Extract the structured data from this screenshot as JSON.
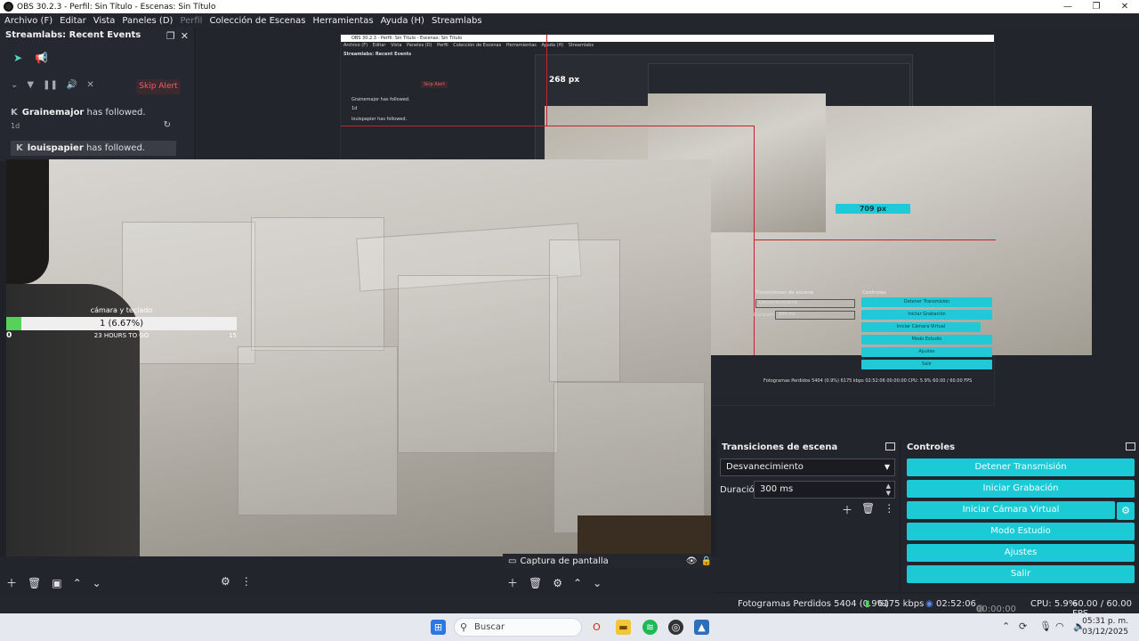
{
  "window": {
    "title": "OBS 30.2.3 - Perfil: Sin Título - Escenas: Sin Título",
    "controls": [
      "—",
      "❐",
      "✕"
    ]
  },
  "menu": {
    "items": [
      "Archivo (F)",
      "Editar",
      "Vista",
      "Paneles (D)",
      "Perfil",
      "Colección de Escenas",
      "Herramientas",
      "Ayuda (H)",
      "Streamlabs"
    ]
  },
  "streamlabs": {
    "title": "Streamlabs: Recent Events",
    "skip_alert": "Skip Alert",
    "events": [
      {
        "user": "Grainemajor",
        "action": " has followed.",
        "time": "1d"
      },
      {
        "user": "louispapier",
        "action": " has followed."
      }
    ]
  },
  "goal": {
    "title": "cámara y teclado",
    "value_text": "1 (6.67%)",
    "progress_fraction": 0.0667,
    "start": "0",
    "remaining": "23 HOURS TO GO",
    "end": "15"
  },
  "nested_preview": {
    "title": "OBS 30.2.3 - Perfil: Sin Título - Escenas: Sin Título",
    "menu": [
      "Archivo (F)",
      "Editar",
      "Vista",
      "Paneles (D)",
      "Perfil",
      "Colección de Escenas",
      "Herramientas",
      "Ayuda (H)",
      "Streamlabs"
    ],
    "dock_title": "Streamlabs: Recent Events",
    "skip_alert": "Skip Alert",
    "event1": "Grainemajor has followed.",
    "event1_time": "1d",
    "event2": "louispapier has followed.",
    "measure_top": "268 px",
    "measure_right": "709 px",
    "trans_title": "Transiciones de escena",
    "controls_title": "Controles",
    "select": "Desvanecimiento",
    "duration_label": "Duración",
    "duration": "300 ms",
    "buttons": [
      "Detener Transmisión",
      "Iniciar Grabación",
      "Iniciar Cámara Virtual",
      "Modo Estudio",
      "Ajustes",
      "Salir"
    ],
    "status": "Fotogramas Perdidos 5404 (0.9%)   6175 kbps   02:52:06   00:00:00   CPU: 5.9%   60.00 / 60.00 FPS"
  },
  "sources": {
    "item_label": "Captura de pantalla"
  },
  "transitions": {
    "title": "Transiciones de escena",
    "selected": "Desvanecimiento",
    "duration_label": "Duración",
    "duration_value": "300 ms"
  },
  "controls": {
    "title": "Controles",
    "stop_stream": "Detener Transmisión",
    "start_recording": "Iniciar Grabación",
    "start_virtual_cam": "Iniciar Cámara Virtual",
    "studio_mode": "Modo Estudio",
    "settings": "Ajustes",
    "exit": "Salir"
  },
  "status": {
    "dropped_frames": "Fotogramas Perdidos 5404 (0.9%)",
    "bitrate": "6175 kbps",
    "stream_time": "02:52:06",
    "record_time": "00:00:00",
    "cpu": "CPU: 5.9%",
    "fps": "60.00 / 60.00 FPS"
  },
  "taskbar": {
    "search_placeholder": "Buscar",
    "time": "05:31 p. m.",
    "date": "03/12/2025"
  },
  "colors": {
    "accent": "#1ccad6",
    "goal_fill": "#56d15a",
    "skip_alert": "#ef5b6a",
    "bounding_red": "#cc1f2a"
  }
}
